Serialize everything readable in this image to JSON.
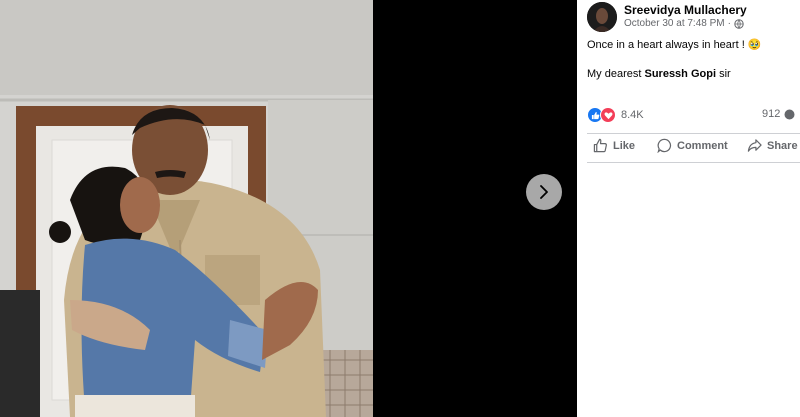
{
  "post": {
    "author": "Sreevidya Mullachery",
    "timestamp": "October 30 at 7:48 PM",
    "privacy_icon": "globe-icon",
    "text_line1": "Once in a heart always in heart !",
    "text_emoji": "🥹",
    "text_line2_prefix": "My dearest",
    "text_line2_name": "Suressh Gopi",
    "text_line2_suffix": "sir"
  },
  "reactions": {
    "types": [
      "like",
      "love"
    ],
    "count": "8.4K",
    "comments": "912"
  },
  "actions": {
    "like_label": "Like",
    "comment_label": "Comment",
    "share_label": "Share"
  },
  "colors": {
    "like_blue": "#1877f2",
    "love_red": "#f33e58",
    "meta_gray": "#65676b",
    "viewer_bg": "#000000"
  },
  "viewer": {
    "next_icon": "chevron-right-icon"
  }
}
